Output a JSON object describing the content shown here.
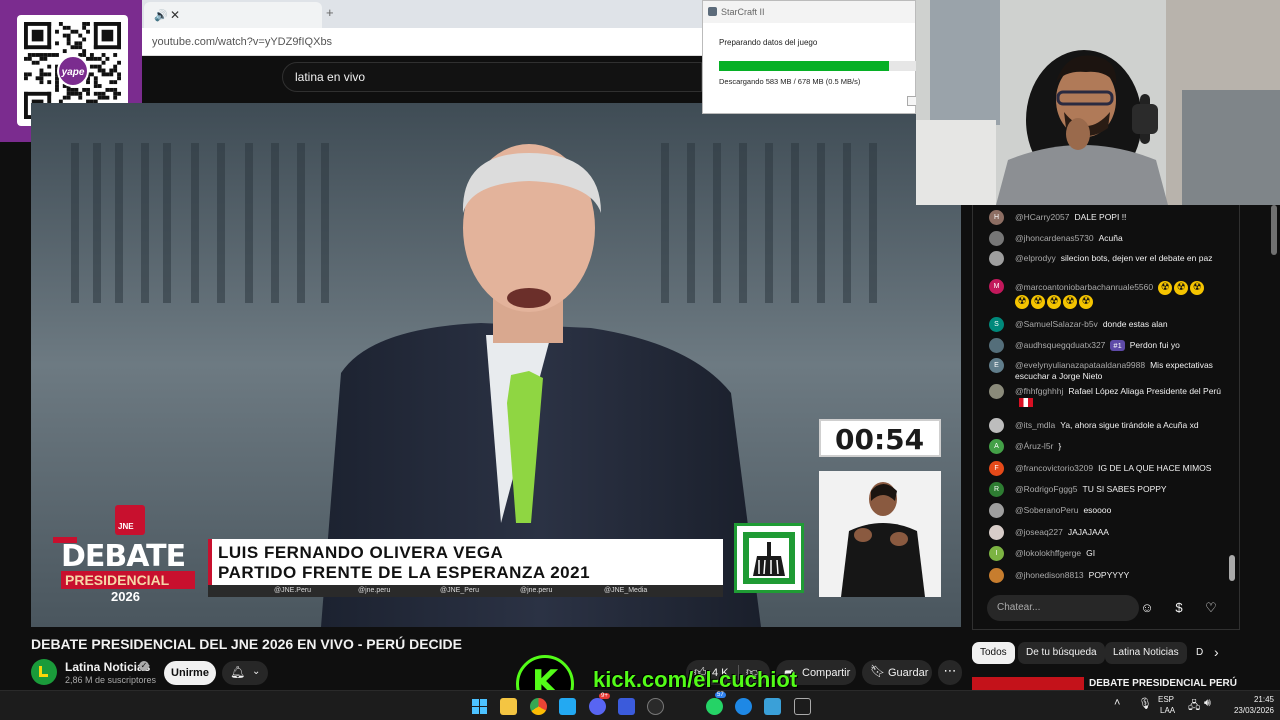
{
  "browser": {
    "address": "youtube.com/watch?v=yYDZ9fIQXbs",
    "search_query": "latina en vivo",
    "tab_speaker_icon": "speaker-icon",
    "tab_close": "✕",
    "new_tab": "+"
  },
  "qr": {
    "logo_text": "yape"
  },
  "game_popup": {
    "title": "StarCraft II",
    "status": "Preparando datos del juego",
    "download": "Descargando 583 MB / 678 MB  (0.5 MB/s)",
    "progress": 0.86
  },
  "video": {
    "timer": "00:54",
    "jne_label": "JNE",
    "debate_label": "DEBATE",
    "presidencial_label": "PRESIDENCIAL",
    "year_label": "2026",
    "lower_third_name": "LUIS FERNANDO OLIVERA VEGA",
    "lower_third_party": "PARTIDO FRENTE DE LA ESPERANZA 2021",
    "socials": [
      "@JNE.Peru",
      "@jne.peru",
      "@JNE_Peru",
      "@jne.peru",
      "@JNE_Media"
    ]
  },
  "page": {
    "title": "DEBATE PRESIDENCIAL DEL JNE 2026 EN VIVO - PERÚ DECIDE",
    "channel_name": "Latina Noticias",
    "channel_subs": "2,86 M de suscriptores",
    "join_label": "Unirme",
    "like_count": "4 K",
    "share_label": "Compartir",
    "save_label": "Guardar",
    "more": "⋯"
  },
  "chat": {
    "input_placeholder": "Chatear...",
    "messages": [
      {
        "avatar": "H",
        "avatar_color": "#8d6e63",
        "user": "@HCarry2057",
        "text": "DALE POPI !!"
      },
      {
        "avatar": "",
        "avatar_color": "#777777",
        "user": "@jhoncardenas5730",
        "text": "Acuña"
      },
      {
        "avatar": "",
        "avatar_color": "#9e9e9e",
        "user": "@elprodyy",
        "text": "silecion bots, dejen ver el debate en paz"
      },
      {
        "avatar": "M",
        "avatar_color": "#c2185b",
        "user": "@marcoantoniobarbachanruale5560",
        "text": "",
        "emoji_count": 8
      },
      {
        "avatar": "S",
        "avatar_color": "#00897b",
        "user": "@SamuelSalazar-b5v",
        "text": "donde estas alan"
      },
      {
        "avatar": "",
        "avatar_color": "#546e7a",
        "user": "@audhsquegqduatx327",
        "badge": "#1",
        "text": "Perdon fui yo"
      },
      {
        "avatar": "E",
        "avatar_color": "#607d8b",
        "user": "@evelynyulianazapataaldana9988",
        "text": "Mis expectativas escuchar a Jorge Nieto"
      },
      {
        "avatar": "",
        "avatar_color": "#8a8a7a",
        "user": "@fhhfgghhhj",
        "text": "Rafael López Aliaga Presidente del Perú"
      },
      {
        "avatar": "",
        "avatar_color": "#bdbdbd",
        "user": "@its_mdla",
        "text": "Ya, ahora sigue tirándole a Acuña xd"
      },
      {
        "avatar": "A",
        "avatar_color": "#43a047",
        "user": "@Áruz-l5r",
        "text": "}"
      },
      {
        "avatar": "F",
        "avatar_color": "#e64a19",
        "user": "@francovictorio3209",
        "text": "IG DE LA QUE HACE MIMOS"
      },
      {
        "avatar": "R",
        "avatar_color": "#2e7d32",
        "user": "@RodrigoFggg5",
        "text": "TU SI SABES POPPY"
      },
      {
        "avatar": "",
        "avatar_color": "#9e9e9e",
        "user": "@SoberanoPeru",
        "text": "esoooo"
      },
      {
        "avatar": "",
        "avatar_color": "#d7ccc8",
        "user": "@joseaq227",
        "text": "JAJAJAAA"
      },
      {
        "avatar": "I",
        "avatar_color": "#7cb342",
        "user": "@lokolokhffgerge",
        "text": "GI"
      },
      {
        "avatar": "",
        "avatar_color": "#c77d2e",
        "user": "@jhonedison8813",
        "text": "POPYYYY"
      }
    ]
  },
  "chips": {
    "items": [
      "Todos",
      "De tu búsqueda",
      "Latina Noticias",
      "D"
    ],
    "rec_title": "DEBATE PRESIDENCIAL PERÚ"
  },
  "kick": {
    "logo": "K",
    "url": "kick.com/el-cuchiot"
  },
  "taskbar": {
    "lang": "ESP",
    "lang_sub": "LAA",
    "time": "21:45",
    "date": "23/03/2026",
    "badge_discord": "9+",
    "badge_whatsapp": "57"
  }
}
